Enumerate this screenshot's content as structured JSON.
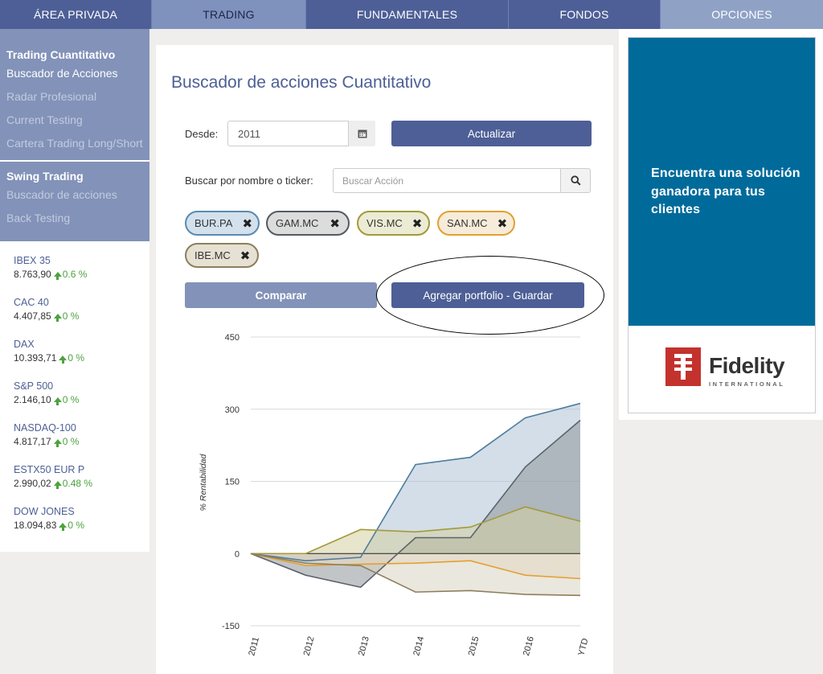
{
  "nav": {
    "tabs": [
      {
        "label": "ÁREA PRIVADA"
      },
      {
        "label": "TRADING"
      },
      {
        "label": "FUNDAMENTALES"
      },
      {
        "label": "FONDOS"
      },
      {
        "label": "OPCIONES"
      }
    ]
  },
  "sidebar": {
    "section1": {
      "heading": "Trading Cuantitativo",
      "items": [
        "Buscador de Acciones",
        "Radar Profesional",
        "Current Testing",
        "Cartera Trading Long/Short"
      ]
    },
    "section2": {
      "heading": "Swing Trading",
      "items": [
        "Buscador de acciones",
        "Back Testing"
      ]
    },
    "markets": [
      {
        "name": "IBEX 35",
        "value": "8.763,90",
        "change": "0.6 %"
      },
      {
        "name": "CAC 40",
        "value": "4.407,85",
        "change": "0 %"
      },
      {
        "name": "DAX",
        "value": "10.393,71",
        "change": "0 %"
      },
      {
        "name": "S&P 500",
        "value": "2.146,10",
        "change": "0 %"
      },
      {
        "name": "NASDAQ-100",
        "value": "4.817,17",
        "change": "0 %"
      },
      {
        "name": "ESTX50 EUR P",
        "value": "2.990,02",
        "change": "0.48 %"
      },
      {
        "name": "DOW JONES",
        "value": "18.094,83",
        "change": "0 %"
      }
    ]
  },
  "main": {
    "title": "Buscador de acciones Cuantitativo",
    "desde_label": "Desde:",
    "desde_value": "2011",
    "actualizar": "Actualizar",
    "search_label": "Buscar por nombre o ticker:",
    "search_placeholder": "Buscar Acción",
    "chips": [
      {
        "label": "BUR.PA",
        "color": "#5b8ab0",
        "bg": "#d3e1ec"
      },
      {
        "label": "GAM.MC",
        "color": "#555b63",
        "bg": "#dcdcdc"
      },
      {
        "label": "VIS.MC",
        "color": "#a39a3a",
        "bg": "#ecebd4"
      },
      {
        "label": "SAN.MC",
        "color": "#e3a032",
        "bg": "#f6ecd9"
      },
      {
        "label": "IBE.MC",
        "color": "#8c7f5c",
        "bg": "#e6e1d3"
      }
    ],
    "comparar": "Comparar",
    "guardar": "Agregar portfolio - Guardar"
  },
  "chart_data": {
    "type": "area",
    "categories": [
      "2011",
      "2012",
      "2013",
      "2014",
      "2015",
      "2016",
      "YTD"
    ],
    "ylabel": "% Rentabilidad",
    "ylim": [
      -150,
      450
    ],
    "yticks": [
      -150,
      0,
      150,
      300,
      450
    ],
    "series": [
      {
        "name": "BUR.PA",
        "color": "#4e7c9e",
        "fill": "#aec3d6",
        "values": [
          0,
          -15,
          -8,
          185,
          200,
          282,
          312
        ]
      },
      {
        "name": "GAM.MC",
        "color": "#5d636b",
        "fill": "#8f959a",
        "values": [
          0,
          -45,
          -70,
          33,
          33,
          180,
          277
        ]
      },
      {
        "name": "VIS.MC",
        "color": "#a39a3a",
        "fill": "#d3cfa0",
        "values": [
          0,
          0,
          50,
          45,
          55,
          97,
          67
        ]
      },
      {
        "name": "SAN.MC",
        "color": "#e3a032",
        "fill": "#f0dcc0",
        "values": [
          0,
          -25,
          -22,
          -20,
          -15,
          -45,
          -52
        ]
      },
      {
        "name": "IBE.MC",
        "color": "#8c7f5c",
        "fill": "#d9d3c2",
        "values": [
          0,
          -20,
          -25,
          -80,
          -77,
          -85,
          -87
        ]
      }
    ]
  },
  "ad": {
    "text": "Encuentra una solución ganadora para tus clientes",
    "logo_word": "Fidelity",
    "logo_sub": "INTERNATIONAL"
  }
}
